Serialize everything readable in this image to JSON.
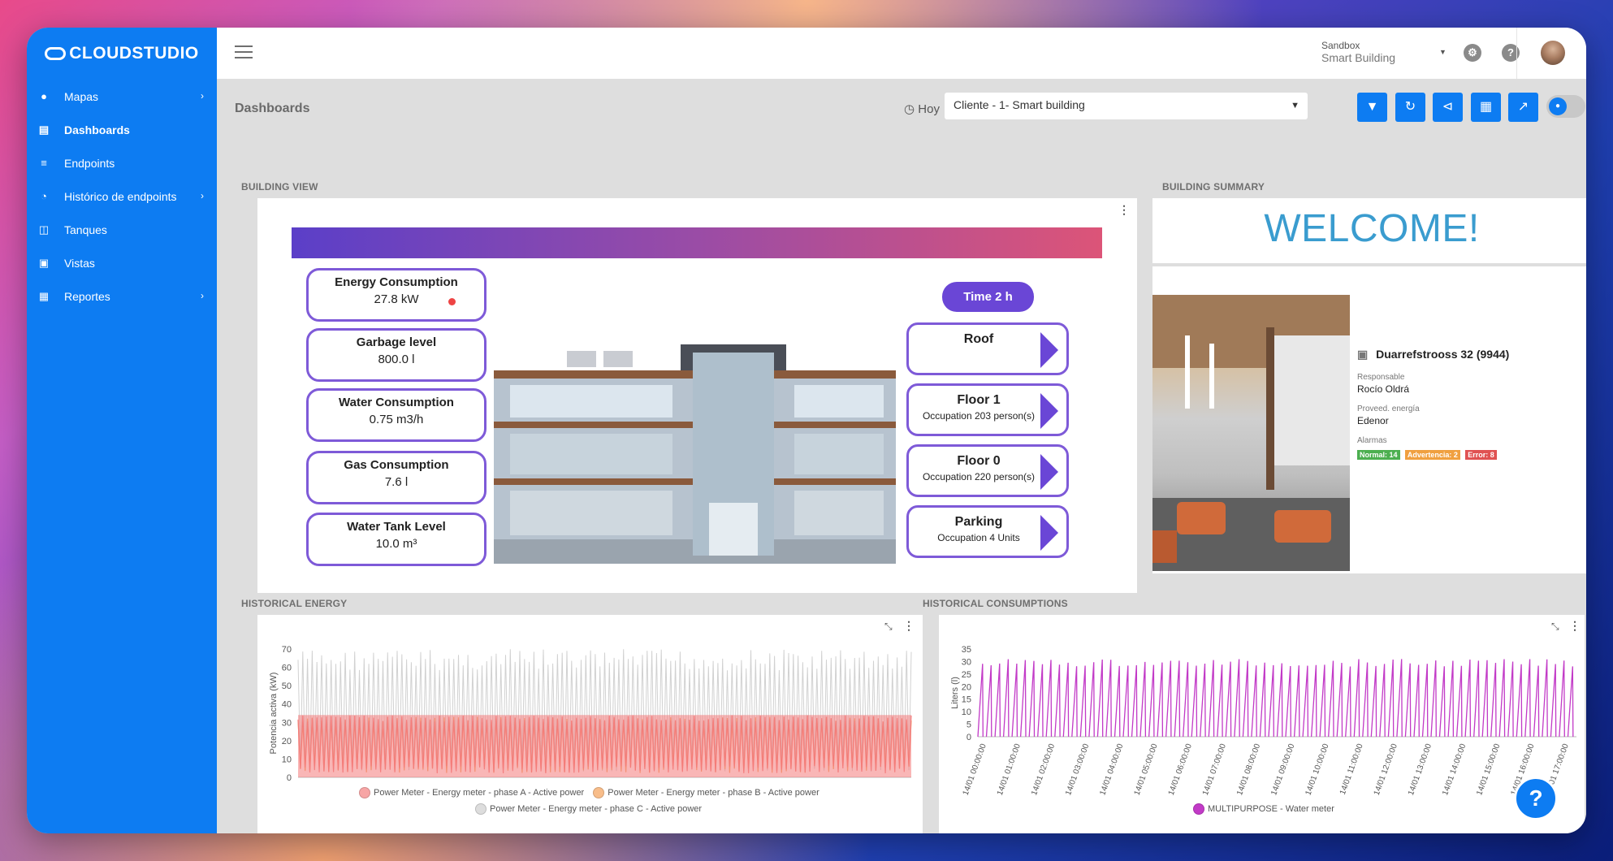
{
  "app": {
    "logo": "CLOUDSTUDIO"
  },
  "sidebar": {
    "items": [
      {
        "label": "Mapas",
        "icon": "globe-icon",
        "has_children": true
      },
      {
        "label": "Dashboards",
        "icon": "chart-icon",
        "active": true
      },
      {
        "label": "Endpoints",
        "icon": "list-icon"
      },
      {
        "label": "Histórico de endpoints",
        "icon": "clock-icon",
        "has_children": true
      },
      {
        "label": "Tanques",
        "icon": "database-icon"
      },
      {
        "label": "Vistas",
        "icon": "image-icon"
      },
      {
        "label": "Reportes",
        "icon": "file-icon",
        "has_children": true
      }
    ]
  },
  "topbar": {
    "tenant": "Sandbox",
    "tenant_sub": "Smart Building"
  },
  "page": {
    "title": "Dashboards",
    "hoy": "Hoy",
    "select_value": "Cliente - 1- Smart building"
  },
  "sections": {
    "building_view": "BUILDING VIEW",
    "building_summary": "BUILDING SUMMARY",
    "historical_energy": "HISTORICAL ENERGY",
    "historical_consumptions": "HISTORICAL CONSUMPTIONS"
  },
  "metrics": [
    {
      "title": "Energy Consumption",
      "value": "27.8 kW",
      "alert": true
    },
    {
      "title": "Garbage level",
      "value": "800.0 l"
    },
    {
      "title": "Water Consumption",
      "value": "0.75 m3/h"
    },
    {
      "title": "Gas Consumption",
      "value": "7.6 l"
    },
    {
      "title": "Water Tank Level",
      "value": "10.0 m³"
    }
  ],
  "time_pill": "Time  2 h",
  "floors": [
    {
      "title": "Roof",
      "occupation": ""
    },
    {
      "title": "Floor 1",
      "occupation_label": "Occupation",
      "occupation": "203 person(s)"
    },
    {
      "title": "Floor 0",
      "occupation_label": "Occupation",
      "occupation": "220 person(s)"
    },
    {
      "title": "Parking",
      "occupation_label": "Occupation",
      "occupation": "4 Units"
    }
  ],
  "summary": {
    "welcome": "WELCOME!",
    "building_name": "Duarrefstrooss 32 (9944)",
    "responsable_label": "Responsable",
    "responsable": "Rocío Oldrá",
    "provider_label": "Proveed. energía",
    "provider": "Edenor",
    "alarms_label": "Alarmas",
    "badges": [
      {
        "text": "Normal: 14",
        "color": "#4caf50"
      },
      {
        "text": "Advertencia: 2",
        "color": "#f0a040"
      },
      {
        "text": "Error: 8",
        "color": "#e05252"
      }
    ]
  },
  "chart_data": [
    {
      "type": "line",
      "title": "HISTORICAL ENERGY",
      "ylabel": "Potencia activa (kW)",
      "ylim": [
        0,
        70
      ],
      "yticks": [
        0,
        10,
        20,
        30,
        40,
        50,
        60,
        70
      ],
      "series": [
        {
          "name": "Power Meter - Energy meter - phase A - Active power",
          "color": "#f47a7a",
          "low": 22,
          "high": 34
        },
        {
          "name": "Power Meter - Energy meter - phase B - Active power",
          "color": "#f5a25a",
          "low": 24,
          "high": 33
        },
        {
          "name": "Power Meter - Energy meter - phase C - Active power",
          "color": "#cccccc",
          "low": 30,
          "high": 70
        }
      ]
    },
    {
      "type": "line",
      "title": "HISTORICAL CONSUMPTIONS",
      "ylabel": "Liters (l)",
      "ylim": [
        0,
        35
      ],
      "yticks": [
        0,
        5,
        10,
        15,
        20,
        25,
        30,
        35
      ],
      "categories": [
        "14/01 00:00:00",
        "14/01 01:00:00",
        "14/01 02:00:00",
        "14/01 03:00:00",
        "14/01 04:00:00",
        "14/01 05:00:00",
        "14/01 06:00:00",
        "14/01 07:00:00",
        "14/01 08:00:00",
        "14/01 09:00:00",
        "14/01 10:00:00",
        "14/01 11:00:00",
        "14/01 12:00:00",
        "14/01 13:00:00",
        "14/01 14:00:00",
        "14/01 15:00:00",
        "14/01 16:00:00",
        "14/01 17:00:00"
      ],
      "series": [
        {
          "name": "MULTIPURPOSE - Water meter",
          "color": "#c23ac7",
          "peak": 31
        }
      ]
    }
  ],
  "colors": {
    "accent": "#0d7cf2",
    "purple": "#6a46d6"
  }
}
